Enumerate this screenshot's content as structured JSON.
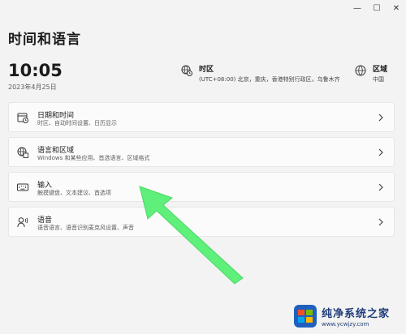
{
  "window": {
    "controls": {
      "minimize": "—",
      "maximize": "☐",
      "close": "✕"
    }
  },
  "header": {
    "title": "时间和语言",
    "time": "10:05",
    "date": "2023年4月25日"
  },
  "timezone": {
    "icon": "timezone-globe-clock-icon",
    "label": "时区",
    "value": "(UTC+08:00) 北京，重庆，香港特别行政区，乌鲁木齐"
  },
  "region": {
    "icon": "globe-icon",
    "label": "区域",
    "value": "中国"
  },
  "cards": [
    {
      "icon": "calendar-clock-icon",
      "title": "日期和时间",
      "subtitle": "时区、自动时间设置、日历显示"
    },
    {
      "icon": "language-globe-icon",
      "title": "语言和区域",
      "subtitle": "Windows 和某些应用、首选语言、区域格式"
    },
    {
      "icon": "keyboard-icon",
      "title": "输入",
      "subtitle": "触摸键盘、文本建议、首选项"
    },
    {
      "icon": "speech-icon",
      "title": "语音",
      "subtitle": "语音语言、语音识别麦克风设置、声音"
    }
  ],
  "annotation": {
    "color": "#5ef07a"
  },
  "watermark": {
    "title": "纯净系统之家",
    "url": "www.ycwjzy.com"
  }
}
